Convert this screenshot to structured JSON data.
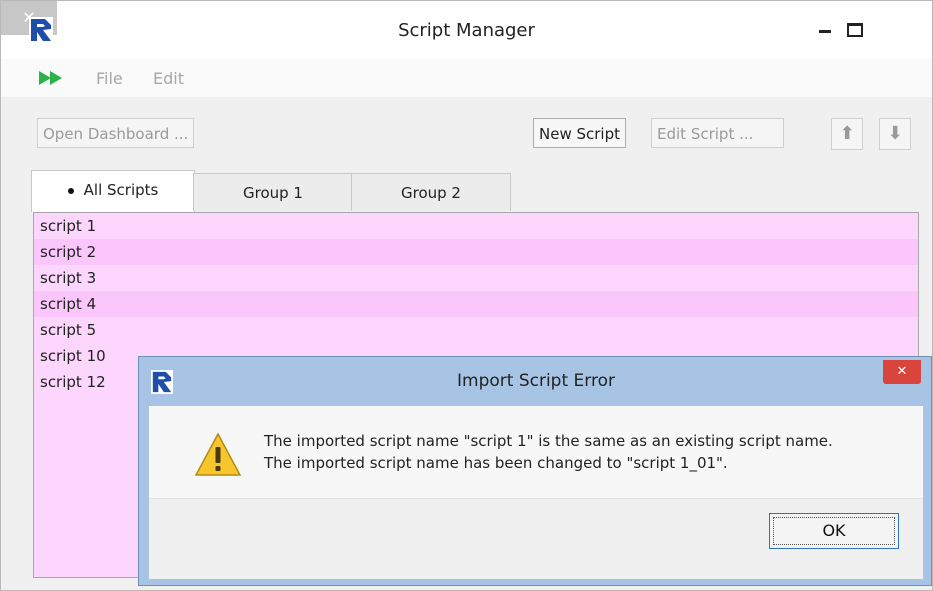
{
  "window": {
    "title": "Script Manager",
    "minimize_glyph": "",
    "maximize_glyph": "",
    "close_glyph": "✕"
  },
  "menu": {
    "items": [
      "File",
      "Edit"
    ]
  },
  "toolbar": {
    "open_dashboard": "Open Dashboard ...",
    "new_script": "New Script",
    "edit_script": "Edit Script ...",
    "move_up": "⬆",
    "move_down": "⬇"
  },
  "tabs": [
    {
      "label": "All Scripts",
      "active": true
    },
    {
      "label": "Group 1",
      "active": false
    },
    {
      "label": "Group 2",
      "active": false
    }
  ],
  "scripts": [
    "script 1",
    "script 2",
    "script 3",
    "script 4",
    "script 5",
    "script 10",
    "script 12"
  ],
  "dialog": {
    "title": "Import Script Error",
    "close_glyph": "✕",
    "message_line1": "The imported script name \"script 1\" is the same as an existing script name.",
    "message_line2": "The imported script name has been changed to \"script 1_01\".",
    "ok_label": "OK"
  },
  "colors": {
    "list_background": "#fdd6fd",
    "list_alt_row": "#fbc6fb",
    "dialog_frame": "#a8c4e4",
    "dialog_close": "#d9453d",
    "app_logo": "#1e4fa8",
    "run_icon": "#2bb24a"
  },
  "icons": {
    "app": "reclamation-logo-icon",
    "run": "run-arrows-icon",
    "warning": "warning-icon"
  }
}
